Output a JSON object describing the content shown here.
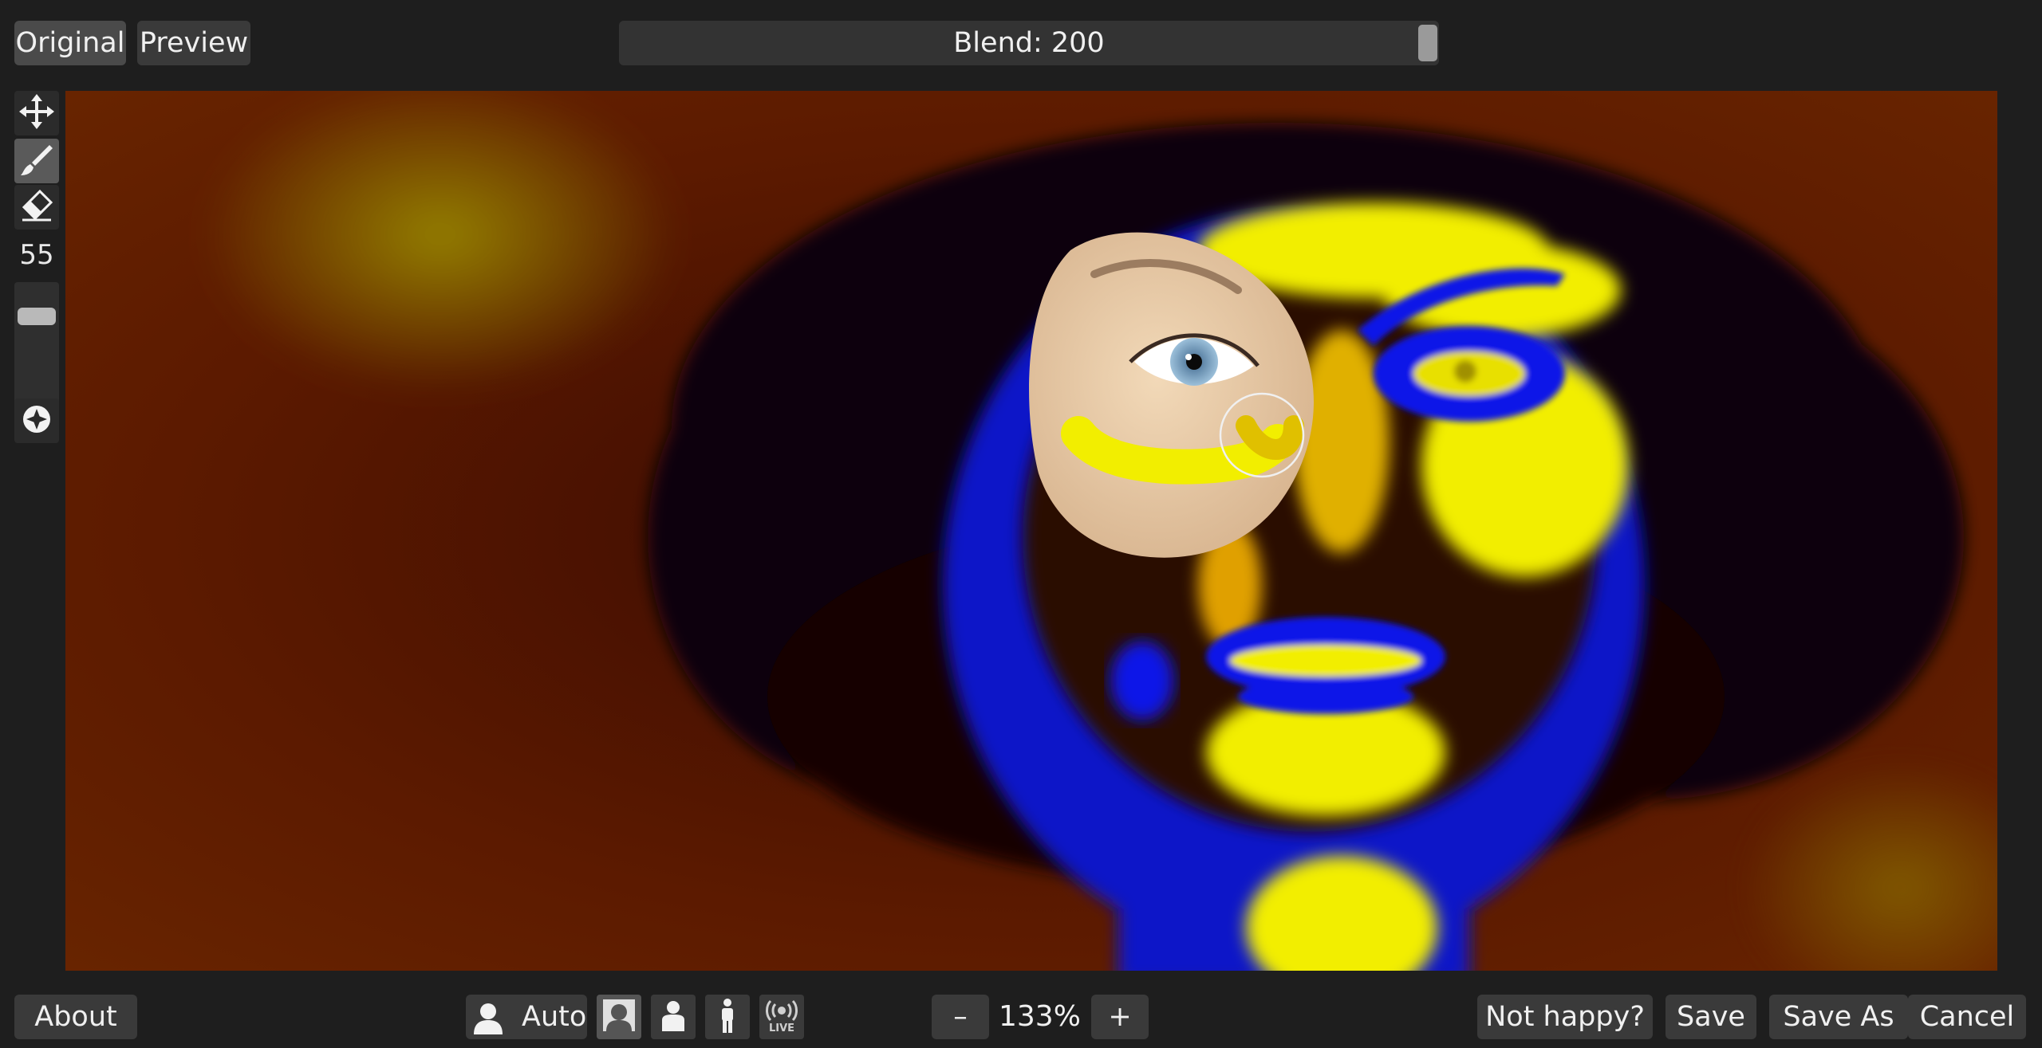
{
  "header": {
    "original_label": "Original",
    "preview_label": "Preview",
    "blend_label": "Blend: 200",
    "blend_value": 200
  },
  "toolbar": {
    "tools": [
      "move-icon",
      "brush-icon",
      "eraser-icon"
    ],
    "active_tool": "brush-icon",
    "brush_size": "55",
    "brush_size_slider_level": 0.25,
    "extra_tool": "navigator-icon"
  },
  "footer": {
    "about_label": "About",
    "auto_label": "Auto",
    "mode_icons": [
      "face-portrait-icon",
      "upper-body-icon",
      "full-body-icon",
      "live-icon"
    ],
    "live_text": "LIVE",
    "zoom_minus": "–",
    "zoom_value": "133%",
    "zoom_plus": "+",
    "not_happy_label": "Not happy?",
    "save_label": "Save",
    "save_as_label": "Save As",
    "cancel_label": "Cancel"
  },
  "colors": {
    "background": "#1e1e1e",
    "button": "#3a3a3a",
    "heatmap_hot": "#f2ee00",
    "heatmap_cold": "#0a18e8",
    "heatmap_base": "#5a1600"
  }
}
